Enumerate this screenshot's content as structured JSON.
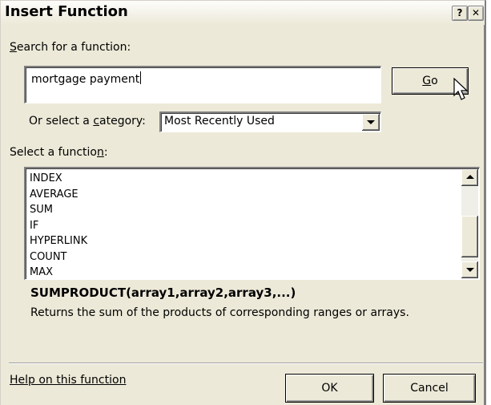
{
  "dialog": {
    "title": "Insert Function",
    "help_button": "?",
    "close_button": "✕"
  },
  "search": {
    "label_prefix": "",
    "label_accel": "S",
    "label_rest": "earch for a function:",
    "value": "mortgage payment",
    "go_accel": "G",
    "go_rest": "o"
  },
  "category": {
    "label_prefix": "Or select a ",
    "label_accel": "c",
    "label_rest": "ategory:",
    "selected": "Most Recently Used"
  },
  "functions": {
    "label_prefix": "Select a functio",
    "label_accel": "n",
    "label_rest": ":",
    "items": [
      "INDEX",
      "AVERAGE",
      "SUM",
      "IF",
      "HYPERLINK",
      "COUNT",
      "MAX"
    ]
  },
  "details": {
    "signature": "SUMPRODUCT(array1,array2,array3,...)",
    "description": "Returns the sum of the products of corresponding ranges or arrays."
  },
  "footer": {
    "help_link": "Help on this function",
    "ok_label": "OK",
    "cancel_label": "Cancel"
  }
}
